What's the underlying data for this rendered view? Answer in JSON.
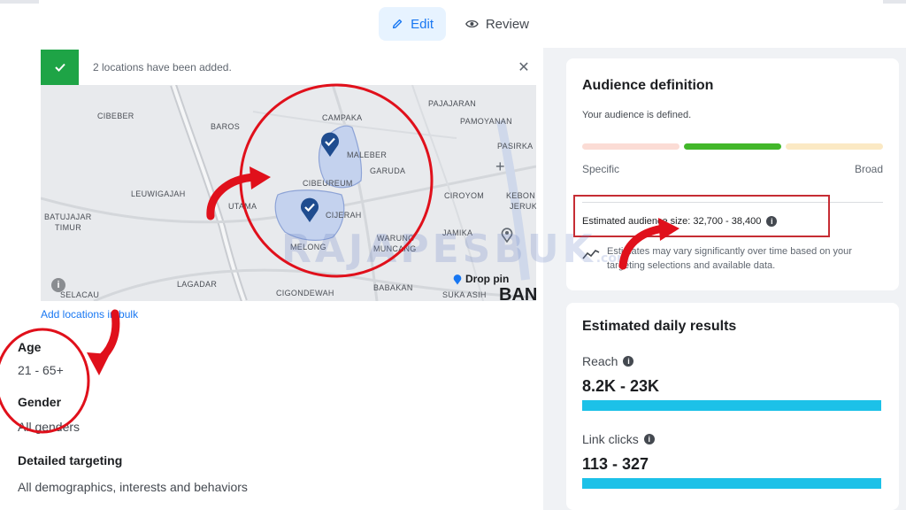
{
  "tabs": {
    "edit_label": "Edit",
    "review_label": "Review"
  },
  "banner": {
    "message": "2 locations have been added.",
    "close": "✕"
  },
  "map": {
    "labels": [
      {
        "text": "CIBEBER"
      },
      {
        "text": "BAROS"
      },
      {
        "text": "CAMPAKA"
      },
      {
        "text": "PAJAJARAN"
      },
      {
        "text": "PAMOYANAN"
      },
      {
        "text": "PASIRKA"
      },
      {
        "text": "MALEBER"
      },
      {
        "text": "GARUDA"
      },
      {
        "text": "CIBEUREUM"
      },
      {
        "text": "LEUWIGAJAH"
      },
      {
        "text": "UTAMA"
      },
      {
        "text": "CIJERAH"
      },
      {
        "text": "CIROYOM"
      },
      {
        "text": "KEBON"
      },
      {
        "text": "JERUK"
      },
      {
        "text": "BATUJAJAR"
      },
      {
        "text": "TIMUR"
      },
      {
        "text": "MELONG"
      },
      {
        "text": "WARUNG"
      },
      {
        "text": "MUNCANG"
      },
      {
        "text": "JAMIKA"
      },
      {
        "text": "SELACAU"
      },
      {
        "text": "LAGADAR"
      },
      {
        "text": "CIGONDEWAH"
      },
      {
        "text": "BABAKAN"
      },
      {
        "text": "SUKA ASIH"
      }
    ],
    "drop_pin_label": "Drop pin",
    "city_label": "BAN",
    "zoom_in": "+",
    "info": "i"
  },
  "bulk_link": "Add locations in bulk",
  "age": {
    "title": "Age",
    "value": "21 - 65+"
  },
  "gender": {
    "title": "Gender",
    "value": "All genders"
  },
  "detailed_targeting": {
    "title": "Detailed targeting",
    "value": "All demographics, interests and behaviors"
  },
  "audience_definition": {
    "title": "Audience definition",
    "status": "Your audience is defined.",
    "scale_left": "Specific",
    "scale_right": "Broad",
    "estimated_size": "Estimated audience size: 32,700 - 38,400",
    "note": "Estimates may vary significantly over time based on your targeting selections and available data."
  },
  "daily_results": {
    "title": "Estimated daily results",
    "reach_label": "Reach",
    "reach_value": "8.2K - 23K",
    "clicks_label": "Link clicks",
    "clicks_value": "113 - 327"
  },
  "watermark": {
    "text": "RAJAPESBUK",
    "suffix": ".com"
  },
  "colors": {
    "accent": "#1877f2",
    "success": "#1ea446",
    "annotation": "#e0101b",
    "result_bar": "#1cc1e8"
  }
}
